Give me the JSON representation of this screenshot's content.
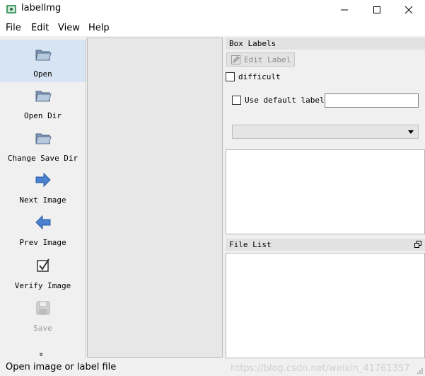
{
  "window": {
    "title": "labelImg"
  },
  "menu": {
    "file": "File",
    "edit": "Edit",
    "view": "View",
    "help": "Help"
  },
  "toolbar": {
    "items": [
      {
        "label": "Open",
        "icon": "open-folder-icon",
        "active": true
      },
      {
        "label": "Open Dir",
        "icon": "open-dir-icon"
      },
      {
        "label": "Change Save Dir",
        "icon": "change-save-dir-icon"
      },
      {
        "label": "Next Image",
        "icon": "arrow-right-icon"
      },
      {
        "label": "Prev Image",
        "icon": "arrow-left-icon"
      },
      {
        "label": "Verify Image",
        "icon": "verify-checkbox-icon"
      },
      {
        "label": "Save",
        "icon": "save-disk-icon",
        "disabled": true
      }
    ],
    "more": "»"
  },
  "box_labels": {
    "title": "Box Labels",
    "edit_label": "Edit Label",
    "difficult": "difficult",
    "use_default_label": "Use default label",
    "default_label_value": ""
  },
  "file_list": {
    "title": "File List"
  },
  "status": {
    "message": "Open image or label file",
    "watermark": "https://blog.csdn.net/weixin_41761357"
  },
  "colors": {
    "active_tool": "#d6e4f3",
    "folder": "#8fa8c4",
    "arrow": "#3c72c2"
  }
}
